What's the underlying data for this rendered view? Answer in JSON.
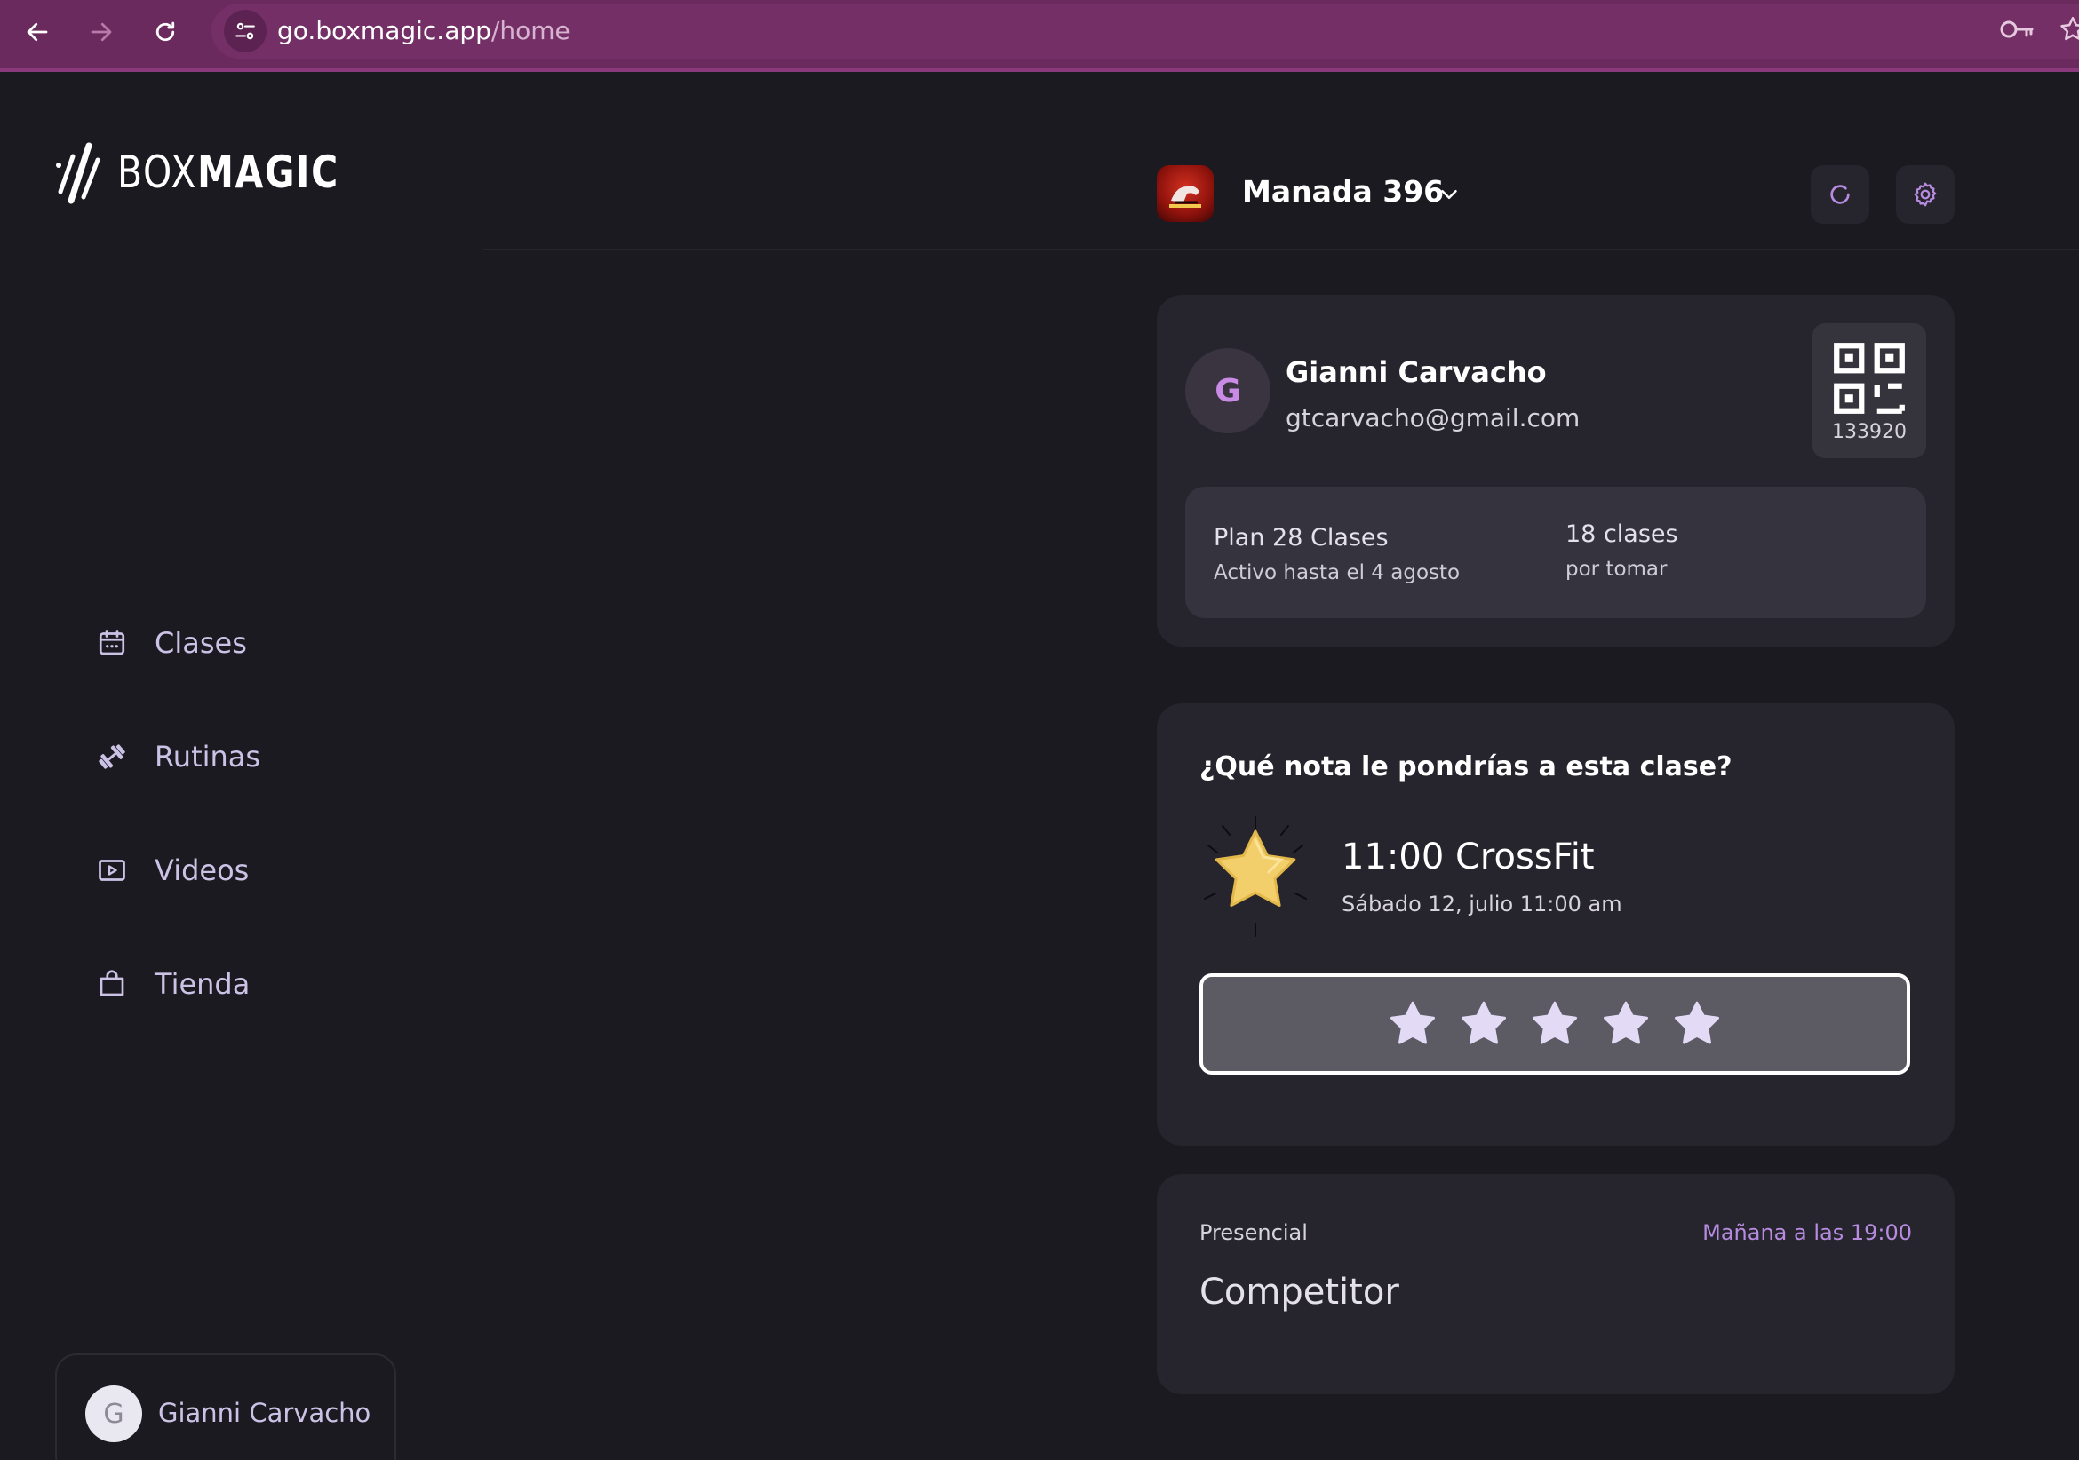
{
  "browser": {
    "url_host": "go.boxmagic.app",
    "url_path": "/home"
  },
  "brand": {
    "logo_text_light": "BOX",
    "logo_text_bold": "MAGIC"
  },
  "sidebar": {
    "items": [
      {
        "label": "Clases",
        "icon": "calendar-icon"
      },
      {
        "label": "Rutinas",
        "icon": "dumbbell-icon"
      },
      {
        "label": "Videos",
        "icon": "video-icon"
      },
      {
        "label": "Tienda",
        "icon": "shopping-bag-icon"
      }
    ],
    "user": {
      "initial": "G",
      "name": "Gianni Carvacho"
    }
  },
  "header": {
    "gym_name": "Manada 396",
    "refresh_icon": "refresh-icon",
    "settings_icon": "gear-icon"
  },
  "profile": {
    "initial": "G",
    "name": "Gianni Carvacho",
    "email": "gtcarvacho@gmail.com",
    "member_code": "133920",
    "plan": {
      "name": "Plan 28 Clases",
      "active_until": "Activo hasta el 4 agosto",
      "classes_count": "18 clases",
      "classes_label": "por tomar"
    }
  },
  "rating": {
    "question": "¿Qué nota le pondrías a esta clase?",
    "class_title": "11:00 CrossFit",
    "class_date": "Sábado 12, julio 11:00 am",
    "stars_total": 5,
    "stars_selected": 0
  },
  "upcoming": {
    "mode": "Presencial",
    "when": "Mañana a las 19:00",
    "class_name": "Competitor"
  },
  "colors": {
    "background": "#1b1a20",
    "card": "#26242c",
    "accent": "#b68be0",
    "browser": "#6b2a5e"
  }
}
